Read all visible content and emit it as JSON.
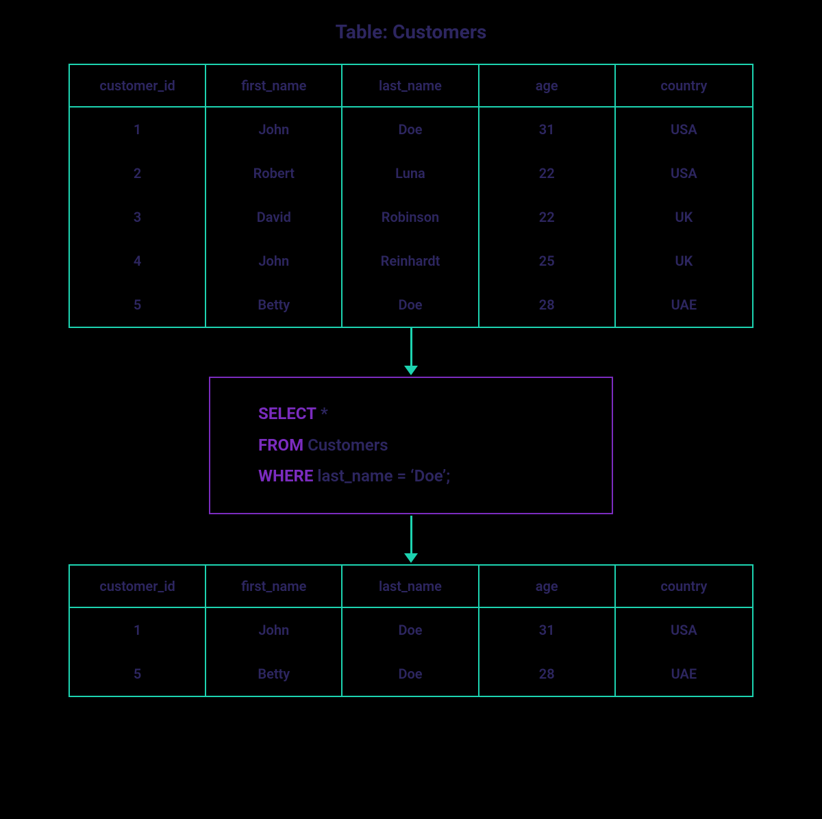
{
  "title": "Table: Customers",
  "source_table": {
    "columns": [
      "customer_id",
      "first_name",
      "last_name",
      "age",
      "country"
    ],
    "rows": [
      {
        "customer_id": "1",
        "first_name": "John",
        "last_name": "Doe",
        "age": "31",
        "country": "USA"
      },
      {
        "customer_id": "2",
        "first_name": "Robert",
        "last_name": "Luna",
        "age": "22",
        "country": "USA"
      },
      {
        "customer_id": "3",
        "first_name": "David",
        "last_name": "Robinson",
        "age": "22",
        "country": "UK"
      },
      {
        "customer_id": "4",
        "first_name": "John",
        "last_name": "Reinhardt",
        "age": "25",
        "country": "UK"
      },
      {
        "customer_id": "5",
        "first_name": "Betty",
        "last_name": "Doe",
        "age": "28",
        "country": "UAE"
      }
    ]
  },
  "query": {
    "keywords": {
      "select": "SELECT",
      "from": "FROM",
      "where": "WHERE"
    },
    "select_cols": "*",
    "from_table": "Customers",
    "where_clause": "last_name = ‘Doe’;"
  },
  "result_table": {
    "columns": [
      "customer_id",
      "first_name",
      "last_name",
      "age",
      "country"
    ],
    "rows": [
      {
        "customer_id": "1",
        "first_name": "John",
        "last_name": "Doe",
        "age": "31",
        "country": "USA"
      },
      {
        "customer_id": "5",
        "first_name": "Betty",
        "last_name": "Doe",
        "age": "28",
        "country": "UAE"
      }
    ]
  }
}
